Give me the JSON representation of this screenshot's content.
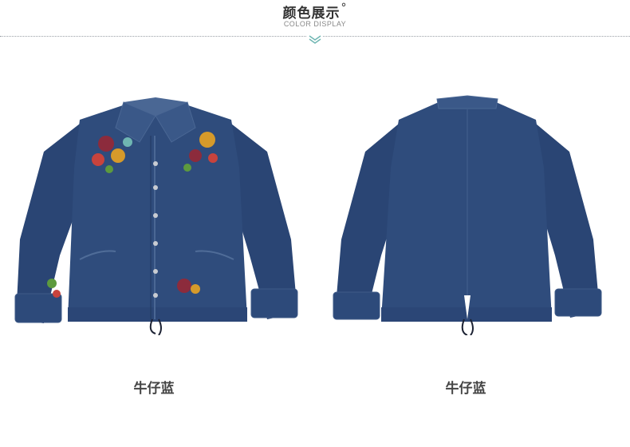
{
  "header": {
    "title": "颜色展示",
    "title_mark": "°",
    "subtitle": "COLOR DISPLAY"
  },
  "colors": {
    "denim_main": "#2f4c7c",
    "denim_dark": "#243d66",
    "denim_light": "#4a6794",
    "accent_teal": "#6fb6b2"
  },
  "products": [
    {
      "view": "front",
      "caption": "牛仔蓝"
    },
    {
      "view": "back",
      "caption": "牛仔蓝"
    }
  ]
}
